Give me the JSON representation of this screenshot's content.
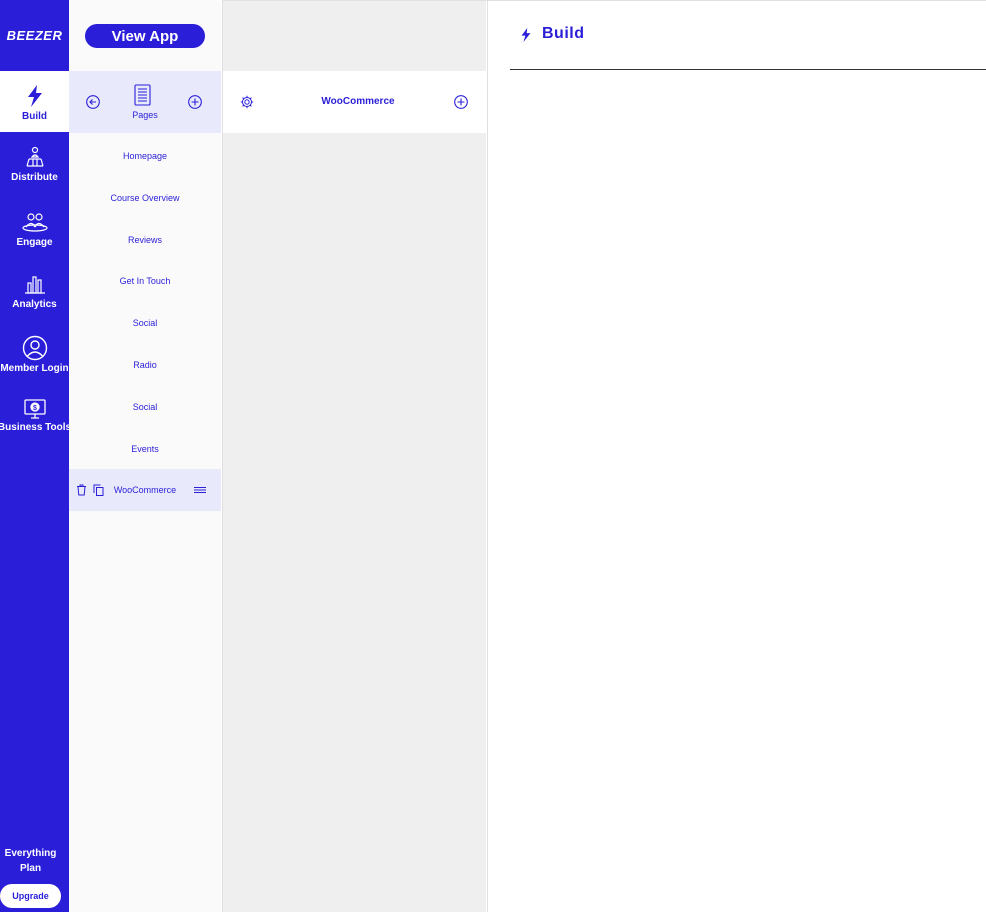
{
  "brand": {
    "logo_text": "BEEZER"
  },
  "nav": {
    "items": [
      {
        "label": "Build",
        "icon": "bolt-icon"
      },
      {
        "label": "Distribute",
        "icon": "distribute-icon"
      },
      {
        "label": "Engage",
        "icon": "users-icon"
      },
      {
        "label": "Analytics",
        "icon": "bar-chart-icon"
      },
      {
        "label": "Member Login",
        "icon": "user-circle-icon"
      },
      {
        "label": "Business Tools",
        "icon": "monitor-dollar-icon"
      }
    ],
    "plan_line1": "Everything",
    "plan_line2": "Plan",
    "upgrade_label": "Upgrade"
  },
  "pages_panel": {
    "view_app_label": "View App",
    "header_label": "Pages",
    "items": [
      "Homepage",
      "Course Overview",
      "Reviews",
      "Get In Touch",
      "Social",
      "Radio",
      "Social",
      "Events",
      "WooCommerce"
    ],
    "selected_index": 8
  },
  "page_panel": {
    "title": "WooCommerce"
  },
  "main": {
    "title": "Build"
  },
  "colors": {
    "accent": "#2a1ed8",
    "selected_bg": "#e8eafc"
  }
}
